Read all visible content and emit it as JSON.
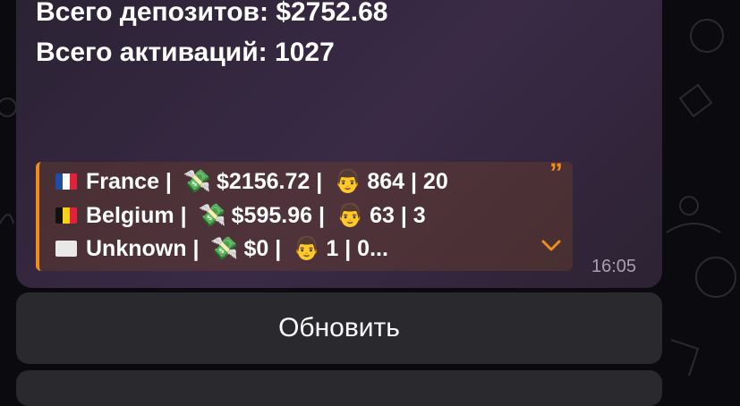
{
  "message": {
    "deposits_line": "Всего депозитов: $2752.68",
    "activations_line": "Всего активаций: 1027",
    "time": "16:05"
  },
  "quote": {
    "rows": [
      {
        "flag": "france-flag",
        "country": "France",
        "amount": "$2156.72",
        "stats": "864 | 20"
      },
      {
        "flag": "belgium-flag",
        "country": "Belgium",
        "amount": "$595.96",
        "stats": "63 | 3"
      },
      {
        "flag": "white-flag",
        "country": "Unknown",
        "amount": "$0",
        "stats": "1 | 0..."
      }
    ],
    "accent_color": "#f08c1a"
  },
  "buttons": {
    "refresh_label": "Обновить"
  }
}
